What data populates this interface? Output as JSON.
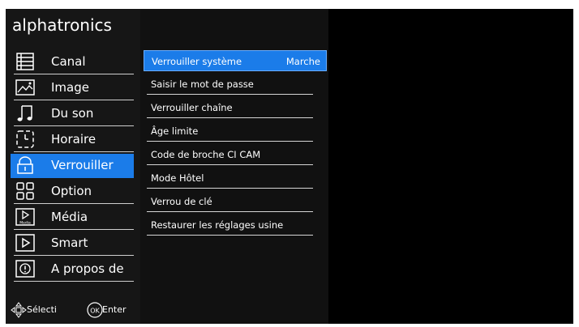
{
  "brand": "alphatronics",
  "sidebar": {
    "items": [
      {
        "label": "Canal",
        "icon": "list-icon"
      },
      {
        "label": "Image",
        "icon": "image-icon"
      },
      {
        "label": "Du son",
        "icon": "music-note-icon"
      },
      {
        "label": "Horaire",
        "icon": "clock-icon"
      },
      {
        "label": "Verrouiller",
        "icon": "lock-icon",
        "active": true
      },
      {
        "label": "Option",
        "icon": "grid-icon"
      },
      {
        "label": "Média",
        "icon": "media-icon",
        "icon_text": "Media"
      },
      {
        "label": "Smart",
        "icon": "play-icon"
      },
      {
        "label": "A propos de",
        "icon": "info-icon"
      }
    ]
  },
  "submenu": {
    "items": [
      {
        "label": "Verrouiller système",
        "value": "Marche",
        "active": true
      },
      {
        "label": "Saisir le mot de passe"
      },
      {
        "label": "Verrouiller chaîne"
      },
      {
        "label": "Âge limite"
      },
      {
        "label": "Code de broche CI CAM"
      },
      {
        "label": "Mode Hôtel"
      },
      {
        "label": "Verrou de clé"
      },
      {
        "label": "Restaurer les réglages usine"
      }
    ]
  },
  "footer": {
    "select_label": "Sélecti",
    "ok_icon_text": "OK",
    "enter_label": "Enter"
  },
  "colors": {
    "accent": "#1b7ce9",
    "sidebar_bg": "#161616",
    "submenu_bg": "#111111",
    "screen_bg": "#000000"
  }
}
